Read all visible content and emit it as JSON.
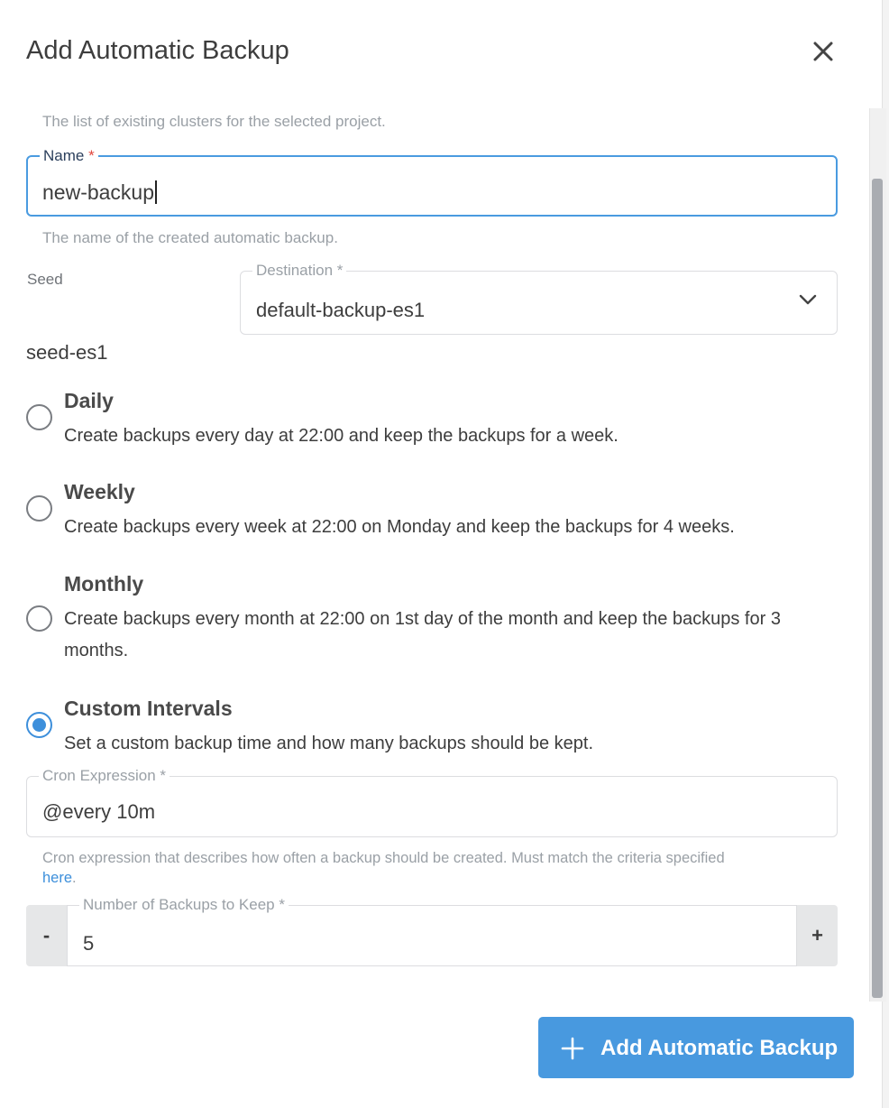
{
  "dialog": {
    "title": "Add Automatic Backup",
    "close_icon": "close-icon"
  },
  "clusters_hint": "The list of existing clusters for the selected project.",
  "name_field": {
    "label": "Name",
    "required_mark": "*",
    "value": "new-backup",
    "hint": "The name of the created automatic backup."
  },
  "seed": {
    "label": "Seed",
    "value": "seed-es1"
  },
  "destination_field": {
    "label": "Destination",
    "required_mark": "*",
    "value": "default-backup-es1",
    "icon": "chevron-down-icon"
  },
  "schedule_options": [
    {
      "title": "Daily",
      "description": "Create backups every day at 22:00 and keep the backups for a week.",
      "checked": false
    },
    {
      "title": "Weekly",
      "description": "Create backups every week at 22:00 on Monday and keep the backups for 4 weeks.",
      "checked": false
    },
    {
      "title": "Monthly",
      "description": "Create backups every month at 22:00 on 1st day of the month and keep the backups for 3 months.",
      "checked": false
    },
    {
      "title": "Custom Intervals",
      "description": "Set a custom backup time and how many backups should be kept.",
      "checked": true
    }
  ],
  "cron_field": {
    "label": "Cron Expression",
    "required_mark": "*",
    "value": "@every 10m",
    "hint": "Cron expression that describes how often a backup should be created. Must match the criteria specified",
    "hint_link": "here",
    "hint_end": "."
  },
  "backups_to_keep": {
    "label": "Number of Backups to Keep",
    "required_mark": "*",
    "value": "5",
    "minus_label": "-",
    "plus_label": "+"
  },
  "submit_button": {
    "label": "Add Automatic Backup",
    "icon": "plus-icon"
  },
  "colors": {
    "accent": "#4899df",
    "focus_border": "#4a9be0",
    "required": "#e0473d",
    "link": "#3d8fdb"
  }
}
